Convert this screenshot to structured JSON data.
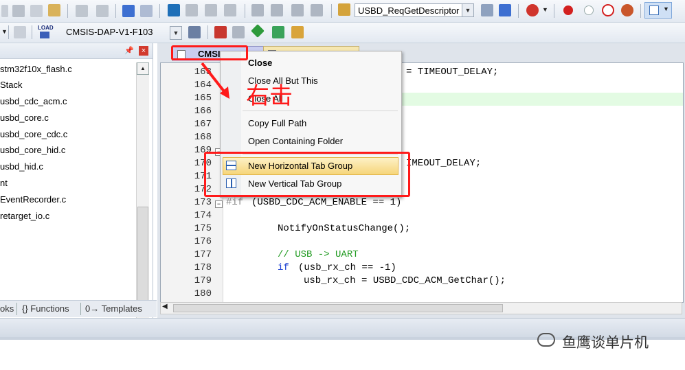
{
  "toolbar": {
    "target_function": "USBD_ReqGetDescriptor",
    "target_device": "CMSIS-DAP-V1-F103",
    "load_label": "LOAD"
  },
  "project_panel": {
    "files": [
      "stm32f10x_flash.c",
      "Stack",
      "usbd_cdc_acm.c",
      "usbd_core.c",
      "usbd_core_cdc.c",
      "usbd_core_hid.c",
      "usbd_hid.c",
      "nt",
      "EventRecorder.c",
      "retarget_io.c"
    ],
    "bottom_tabs": [
      "oks",
      "{} Functions",
      "0→ Templates"
    ]
  },
  "editor": {
    "active_tab": "CMSI",
    "line_numbers": [
      "163",
      "164",
      "165",
      "166",
      "167",
      "168",
      "169",
      "170",
      "171",
      "172",
      "173",
      "174",
      "175",
      "176",
      "177",
      "178",
      "179",
      "180"
    ],
    "code_fragments": {
      "l163": "= TIMEOUT_DELAY;",
      "l170": "IMEOUT_DELAY;",
      "l173_kw": "#if",
      "l173_rest": "(USBD_CDC_ACM_ENABLE == 1)",
      "l175": "NotifyOnStatusChange();",
      "l177": "// USB -> UART",
      "l178_kw": "if",
      "l178_rest": "(usb_rx_ch == -1)",
      "l179": "usb_rx_ch = USBD_CDC_ACM_GetChar();",
      "l179_colon": ""
    }
  },
  "context_menu": {
    "items": [
      "Close",
      "Close All But This",
      "Close All",
      "Copy Full Path",
      "Open Containing Folder",
      "New Horizontal Tab Group",
      "New Vertical Tab Group"
    ]
  },
  "annotation": {
    "label": "右击",
    "color": "#ff1a1a"
  },
  "watermark": "鱼鹰谈单片机"
}
